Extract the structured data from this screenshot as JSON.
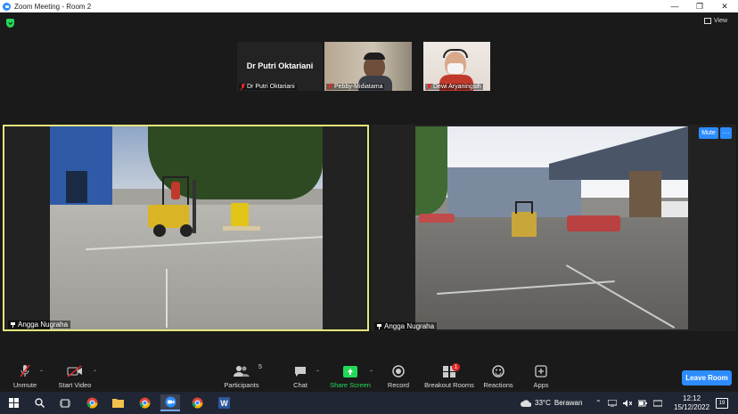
{
  "window": {
    "title": "Zoom Meeting - Room 2"
  },
  "header": {
    "view_label": "View"
  },
  "thumbnails": [
    {
      "display_name": "Dr Putri Oktariani",
      "label": "Dr Putri Oktariani"
    },
    {
      "label": "Pebby-Midiatama"
    },
    {
      "label": "Dewi Aryaningsih"
    }
  ],
  "videos": [
    {
      "label": "Angga Nugraha"
    },
    {
      "label": "Angga Nugraha"
    }
  ],
  "video_controls": {
    "mute_label": "Mute",
    "more_label": "···"
  },
  "toolbar": {
    "unmute": "Unmute",
    "start_video": "Start Video",
    "participants": "Participants",
    "participants_count": "5",
    "chat": "Chat",
    "share_screen": "Share Screen",
    "record": "Record",
    "breakout_rooms": "Breakout Rooms",
    "breakout_badge": "1",
    "reactions": "Reactions",
    "apps": "Apps",
    "leave_room": "Leave Room"
  },
  "taskbar": {
    "temperature": "33°C",
    "weather": "Berawan",
    "time": "12:12",
    "date": "15/12/2022",
    "notification_count": "19"
  },
  "colors": {
    "accent": "#2d8cff",
    "active_speaker_border": "#e6e67a",
    "share_green": "#23d959",
    "muted_red": "#e02828"
  }
}
